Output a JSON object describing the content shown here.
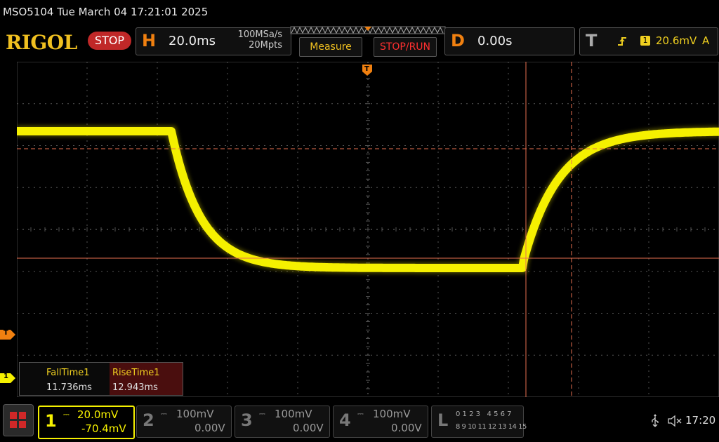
{
  "title": "MSO5104  Tue March 04 17:21:01 2025",
  "logo": "RIGOL",
  "run_state": "STOP",
  "horizontal": {
    "letter": "H",
    "timebase": "20.0ms",
    "sample_rate": "100MSa/s",
    "memory": "20Mpts"
  },
  "buttons": {
    "measure": "Measure",
    "stop_run": "STOP/RUN"
  },
  "delay": {
    "letter": "D",
    "value": "0.00s"
  },
  "trigger": {
    "letter": "T",
    "channel": "1",
    "level": "20.6mV",
    "mode": "A"
  },
  "markers": {
    "trigger_top": "T",
    "trigger_left": "T",
    "ch1_left": "1"
  },
  "measurements": {
    "fall_label": "FallTime1",
    "fall_value": "11.736ms",
    "rise_label": "RiseTime1",
    "rise_value": "12.943ms"
  },
  "channels": [
    {
      "num": "1",
      "scale": "20.0mV",
      "offset": "-70.4mV"
    },
    {
      "num": "2",
      "scale": "100mV",
      "offset": "0.00V"
    },
    {
      "num": "3",
      "scale": "100mV",
      "offset": "0.00V"
    },
    {
      "num": "4",
      "scale": "100mV",
      "offset": "0.00V"
    }
  ],
  "logic": {
    "letter": "L",
    "row1": "0 1 2 3   4 5 6 7",
    "row2": "8 9 10 11 12 13 14 15"
  },
  "status": {
    "time": "17:20"
  },
  "colors": {
    "trace": "#f5f000",
    "accent": "#f08010",
    "stop": "#c02828",
    "cursor": "#e87050"
  }
}
